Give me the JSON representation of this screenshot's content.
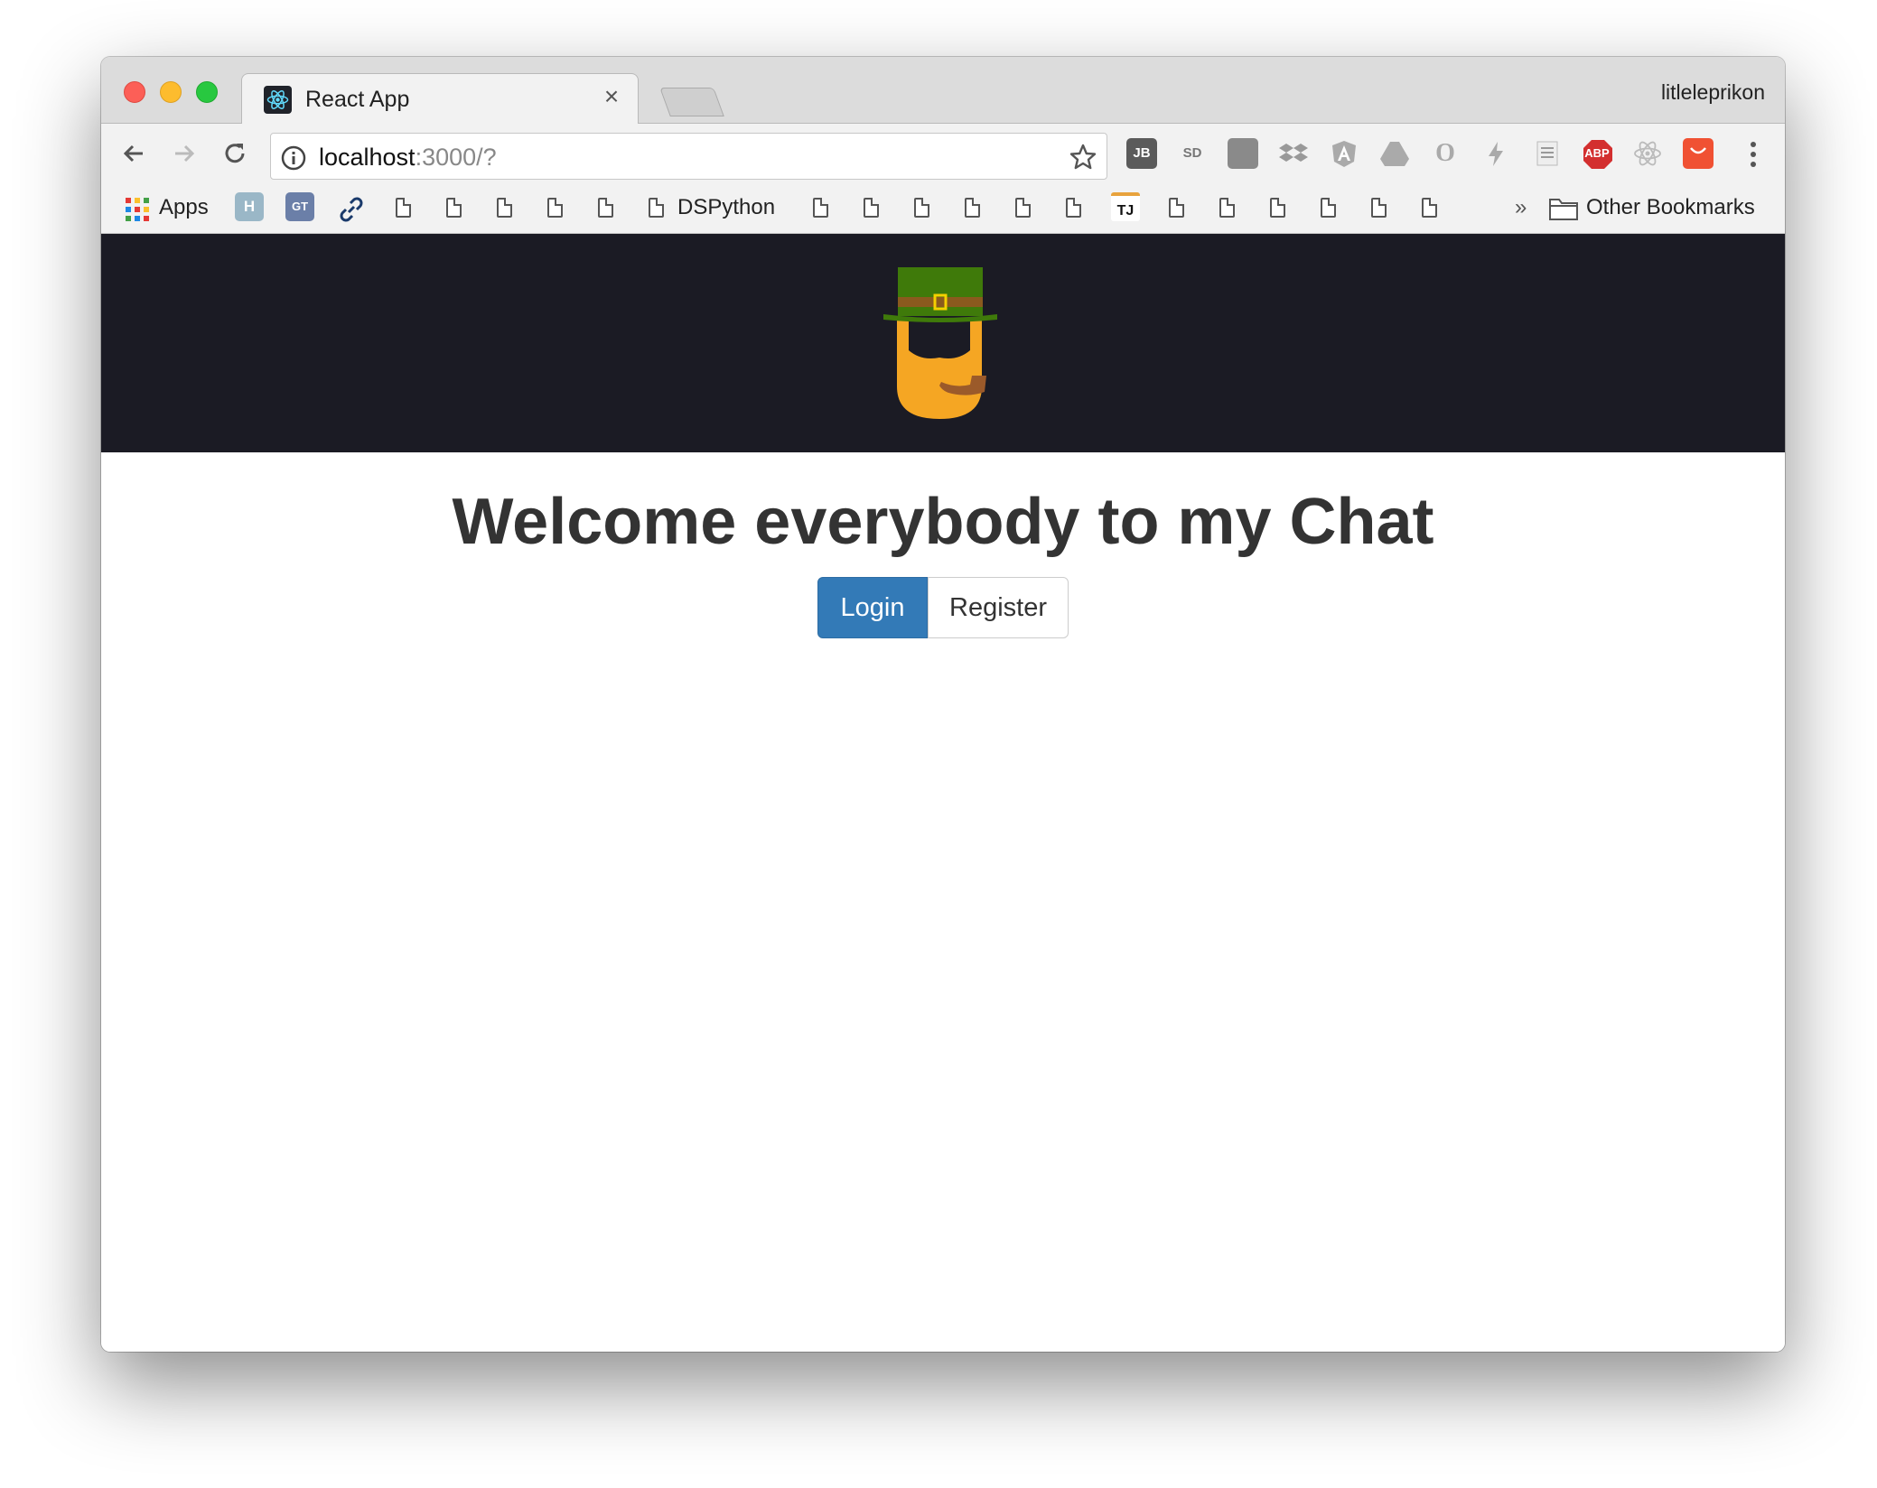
{
  "browser": {
    "tab": {
      "title": "React App",
      "close_glyph": "×"
    },
    "profile": "litleleprikon",
    "address": {
      "host": "localhost",
      "rest": ":3000/?"
    },
    "extensions": [
      "JB",
      "SD",
      "ABP"
    ],
    "bookmarks": {
      "apps_label": "Apps",
      "h_label": "H",
      "gt_label": "GT",
      "dspython_label": "DSPython",
      "tj_label": "TJ",
      "chevron": "»",
      "other_label": "Other Bookmarks"
    }
  },
  "icons": [
    "back-icon",
    "forward-icon",
    "reload-icon",
    "info-icon",
    "star-icon",
    "menu-icon",
    "folder-icon",
    "page-icon",
    "leprechaun-logo"
  ],
  "app": {
    "heading": "Welcome everybody to my Chat",
    "login_label": "Login",
    "register_label": "Register"
  },
  "colors": {
    "header_bg": "#1b1b24",
    "primary": "#337ab7",
    "hat": "#3f7a0a",
    "beard": "#f5a623"
  }
}
